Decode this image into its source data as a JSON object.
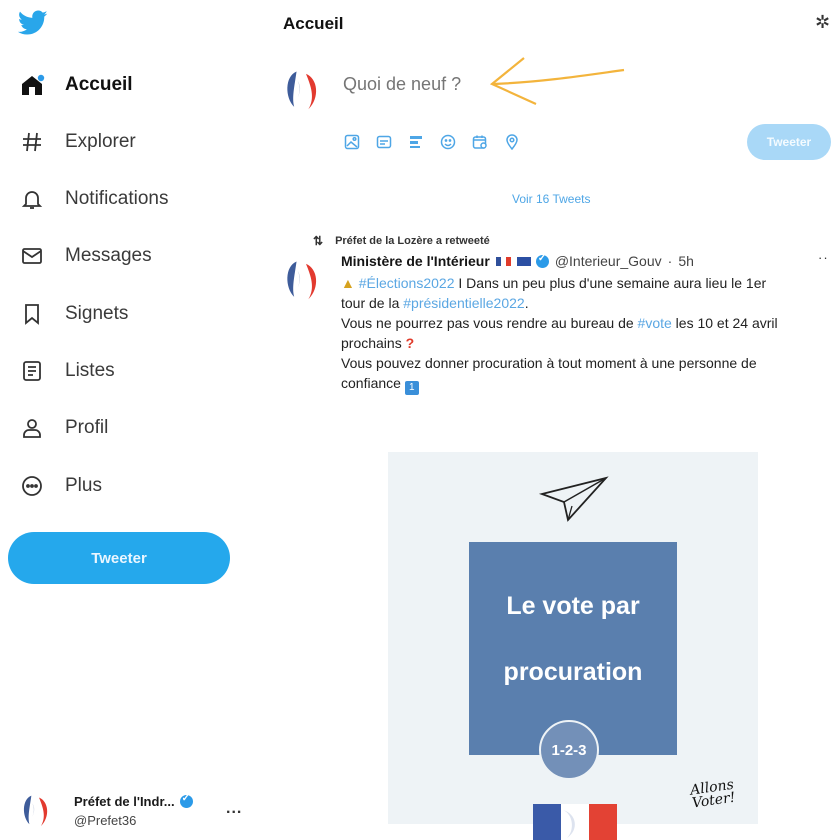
{
  "sidebar": {
    "brand_icon": "twitter-bird-icon",
    "items": [
      {
        "label": "Accueil",
        "icon": "home-icon",
        "active": true
      },
      {
        "label": "Explorer",
        "icon": "hashtag-icon"
      },
      {
        "label": "Notifications",
        "icon": "bell-icon"
      },
      {
        "label": "Messages",
        "icon": "envelope-icon"
      },
      {
        "label": "Signets",
        "icon": "bookmark-icon"
      },
      {
        "label": "Listes",
        "icon": "list-icon"
      },
      {
        "label": "Profil",
        "icon": "person-icon"
      },
      {
        "label": "Plus",
        "icon": "more-circle-icon"
      }
    ],
    "tweet_button": "Tweeter",
    "account": {
      "name": "Préfet de l'Indr...",
      "handle": "@Prefet36",
      "more": "..."
    }
  },
  "header": {
    "title": "Accueil"
  },
  "composer": {
    "placeholder": "Quoi de neuf ?",
    "tools": [
      "image-icon",
      "gif-icon",
      "poll-icon",
      "emoji-icon",
      "schedule-icon",
      "location-icon"
    ],
    "button": "Tweeter"
  },
  "timeline": {
    "show_more": "Voir 16 Tweets",
    "tweet": {
      "retweeted_by": "Préfet de la Lozère a retweeté",
      "author_name": "Ministère de l'Intérieur",
      "handle": "@Interieur_Gouv",
      "time": "5h",
      "line1_hashtag": "#Élections2022",
      "line1_text": " I Dans un peu plus d'une semaine aura lieu le 1er",
      "line2_text": "tour de la ",
      "line2_hashtag": "#présidentielle2022",
      "line2_end": ".",
      "line3_text": "Vous ne pourrez pas vous rendre au bureau de ",
      "line3_hashtag": "#vote",
      "line3_end": " les 10 et 24 avril",
      "line4_text": "prochains",
      "line5_text": "Vous pouvez donner procuration à tout moment à une personne de",
      "line6_text": "confiance",
      "line6_badge": "1",
      "image": {
        "title_line1": "Le vote par",
        "title_line2": "procuration",
        "steps": "1-2-3",
        "signature": "Allons Voter!"
      }
    }
  },
  "colors": {
    "accent": "#25a8ec",
    "hashtag": "#5ba7e3",
    "vote_box": "#5a7fae",
    "arrow": "#f3b43c"
  }
}
